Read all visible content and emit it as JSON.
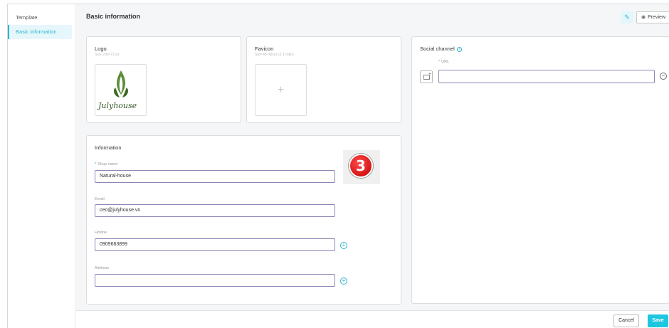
{
  "sidebar": {
    "items": [
      {
        "label": "Template"
      },
      {
        "label": "Basic information"
      }
    ]
  },
  "header": {
    "title": "Basic information",
    "preview_label": "Preview"
  },
  "logo_card": {
    "title": "Logo",
    "hint": "Size 200×72 px",
    "logo_text": "Julyhouse"
  },
  "favicon_card": {
    "title": "Favicon",
    "hint": "Size 48×48 px (1:1 ratio)"
  },
  "info_card": {
    "title": "Information",
    "shop_name_label": "Shop name",
    "shop_name_value": "Natural-house",
    "email_label": "Email",
    "email_value": "ceo@julyhouse.vn",
    "hotline_label": "Hotline",
    "hotline_value": "0909663899",
    "address_label": "Address",
    "address_value": "",
    "step_badge": "3"
  },
  "social_card": {
    "title": "Social channel",
    "url_label": "URL",
    "url_value": ""
  },
  "footer": {
    "cancel_label": "Cancel",
    "save_label": "Save"
  },
  "colors": {
    "accent": "#2bb5cf",
    "save": "#1ec7e0",
    "input_border": "#8c85b6",
    "badge": "#d10000"
  }
}
